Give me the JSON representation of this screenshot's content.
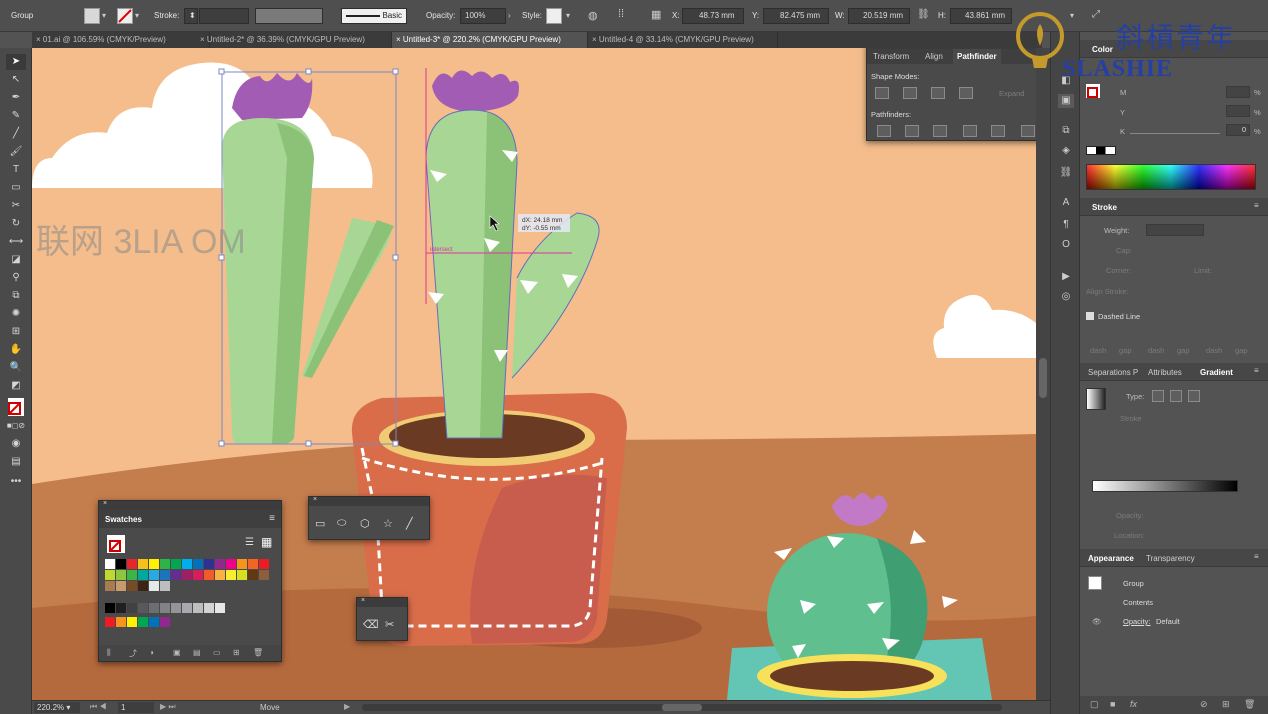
{
  "control_bar": {
    "selection_label": "Group",
    "stroke_label": "Stroke:",
    "brush_label": "Basic",
    "opacity_label": "Opacity:",
    "opacity_value": "100%",
    "style_label": "Style:",
    "x_label": "X:",
    "x_value": "48.73 mm",
    "y_label": "Y:",
    "y_value": "82.475 mm",
    "w_label": "W:",
    "w_value": "20.519 mm",
    "h_label": "H:",
    "h_value": "43.861 mm"
  },
  "doc_tabs": [
    {
      "label": "01.ai @ 106.59% (CMYK/Preview)"
    },
    {
      "label": "Untitled-2* @ 36.39% (CMYK/GPU Preview)"
    },
    {
      "label": "Untitled-3* @ 220.2% (CMYK/GPU Preview)"
    },
    {
      "label": "Untitled-4 @ 33.14% (CMYK/GPU Preview)"
    }
  ],
  "pathfinder_panel": {
    "tabs": [
      "Transform",
      "Align",
      "Pathfinder"
    ],
    "shape_modes_label": "Shape Modes:",
    "pathfinders_label": "Pathfinders:",
    "expand_label": "Expand"
  },
  "smart_guide": {
    "dx": "dX: 24.18 mm",
    "dy": "dY: -0.55 mm",
    "intersect": "intersect"
  },
  "watermark": {
    "brand_cn": "斜槓青年",
    "brand_en": "SLASHIE",
    "canvas_text": "联网 3LIA     OM"
  },
  "color_panel": {
    "title": "Color",
    "m_label": "M",
    "y_label": "Y",
    "k_label": "K",
    "k_value": "0",
    "pct": "%"
  },
  "stroke_panel": {
    "title": "Stroke",
    "weight_label": "Weight:",
    "cap_label": "Cap:",
    "corner_label": "Corner:",
    "limit_label": "Limit:",
    "align_label": "Align Stroke:",
    "dashed_label": "Dashed Line",
    "dash_labels": [
      "dash",
      "gap",
      "dash",
      "gap",
      "dash",
      "gap"
    ]
  },
  "gradient_panel": {
    "tabs": [
      "Separations P",
      "Attributes",
      "Gradient"
    ],
    "type_label": "Type:",
    "stroke_label": "Stroke",
    "opacity_label": "Opacity:",
    "location_label": "Location:"
  },
  "appearance_panel": {
    "tabs": [
      "Appearance",
      "Transparency"
    ],
    "group_label": "Group",
    "contents_label": "Contents",
    "opacity_label": "Opacity:",
    "opacity_value": "Default"
  },
  "swatches_panel": {
    "title": "Swatches",
    "colors": [
      "#ffffff",
      "#000000",
      "#e8262a",
      "#f6c11b",
      "#fff200",
      "#2db34a",
      "#00a651",
      "#00aeef",
      "#0072bc",
      "#2e3192",
      "#92278f",
      "#ec008c",
      "#f7941d",
      "#f26522",
      "#ed1c24",
      "#c1d82f",
      "#8dc63f",
      "#39b54a",
      "#00a99d",
      "#27aae1",
      "#1c75bc",
      "#662d91",
      "#9e1f63",
      "#d91c5c",
      "#f15a29",
      "#fbb040",
      "#f9ed32",
      "#d7df23",
      "#603913",
      "#8b5e3c",
      "#a97c50",
      "#c69c6d",
      "#754c24",
      "#3c2415",
      "#e6e7e8",
      "#bcbec0"
    ],
    "gray_colors": [
      "#000000",
      "#231f20",
      "#414042",
      "#58595b",
      "#6d6e71",
      "#808285",
      "#939598",
      "#a7a9ac",
      "#bcbec0",
      "#d1d3d4",
      "#e6e7e8"
    ],
    "group_colors": [
      "#ed1c24",
      "#f7941d",
      "#fff200",
      "#00a651",
      "#0072bc",
      "#92278f"
    ]
  },
  "status_bar": {
    "zoom": "220.2%",
    "artboard": "1",
    "tool_status": "Move"
  }
}
